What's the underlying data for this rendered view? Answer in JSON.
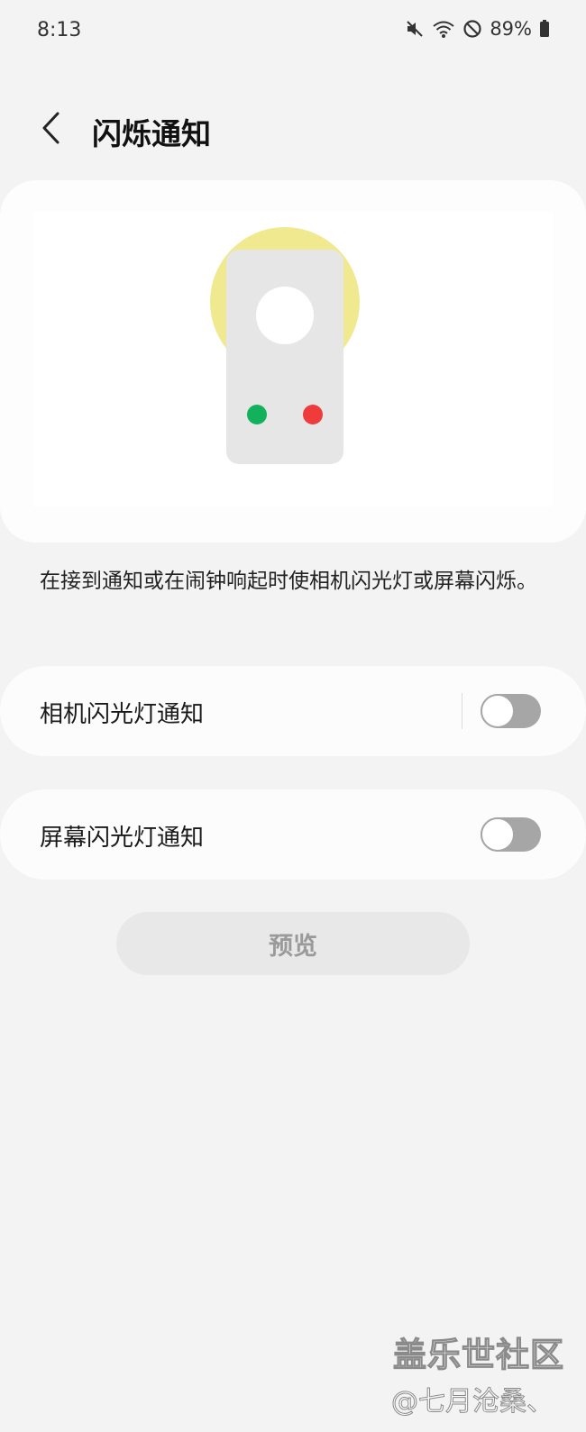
{
  "status_bar": {
    "time": "8:13",
    "battery": "89%",
    "icons": [
      "mute-icon",
      "wifi-icon",
      "do-not-disturb-icon",
      "battery-icon"
    ]
  },
  "header": {
    "title": "闪烁通知",
    "back_icon": "chevron-left-icon"
  },
  "illustration": {
    "glow_color": "#f1e98f",
    "device_color": "#e6e6e6",
    "dot_colors": [
      "#12b25c",
      "#ef3b3b"
    ]
  },
  "description": "在接到通知或在闹钟响起时使相机闪光灯或屏幕闪烁。",
  "settings": [
    {
      "label": "相机闪光灯通知",
      "enabled": false
    },
    {
      "label": "屏幕闪光灯通知",
      "enabled": false
    }
  ],
  "preview_button": "预览",
  "watermark": {
    "main": "盖乐世社区",
    "sub": "@七月沧桑、"
  }
}
